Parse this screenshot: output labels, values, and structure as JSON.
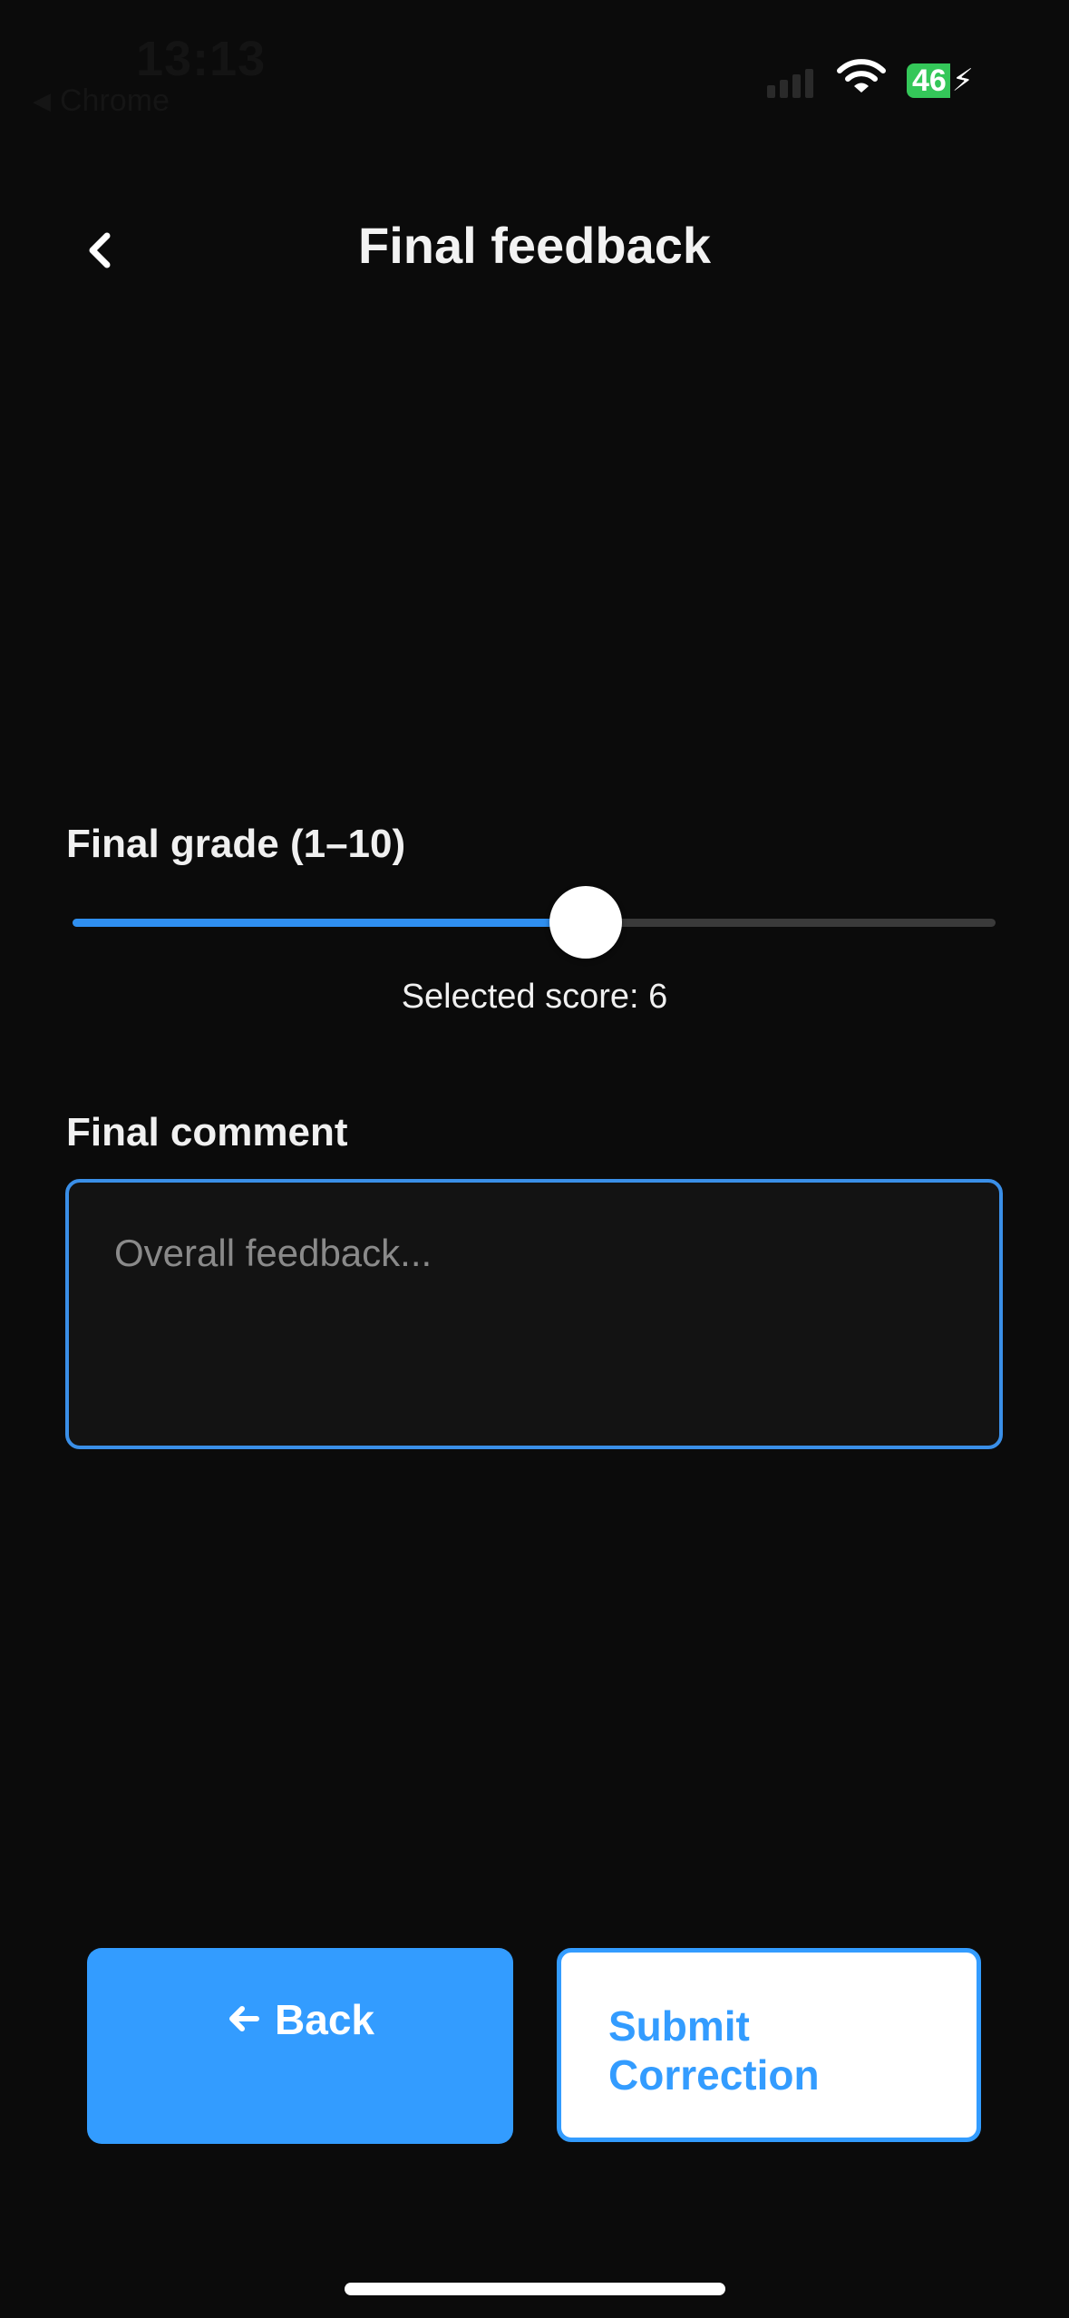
{
  "status_bar": {
    "time": "13:13",
    "back_app": "Chrome",
    "battery": "46"
  },
  "header": {
    "title": "Final feedback",
    "back_icon": "chevron-left-icon"
  },
  "grade": {
    "label": "Final grade (1–10)",
    "min": 1,
    "max": 10,
    "value": 6,
    "score_text": "Selected score: 6"
  },
  "comment": {
    "label": "Final comment",
    "value": "",
    "placeholder": "Overall feedback..."
  },
  "actions": {
    "back_label": "Back",
    "back_icon": "arrow-left-icon",
    "submit_label_line1": "Submit",
    "submit_label_line2": "Correction"
  },
  "colors": {
    "background": "#0b0b0b",
    "accent": "#339cff",
    "battery": "#34c759"
  }
}
